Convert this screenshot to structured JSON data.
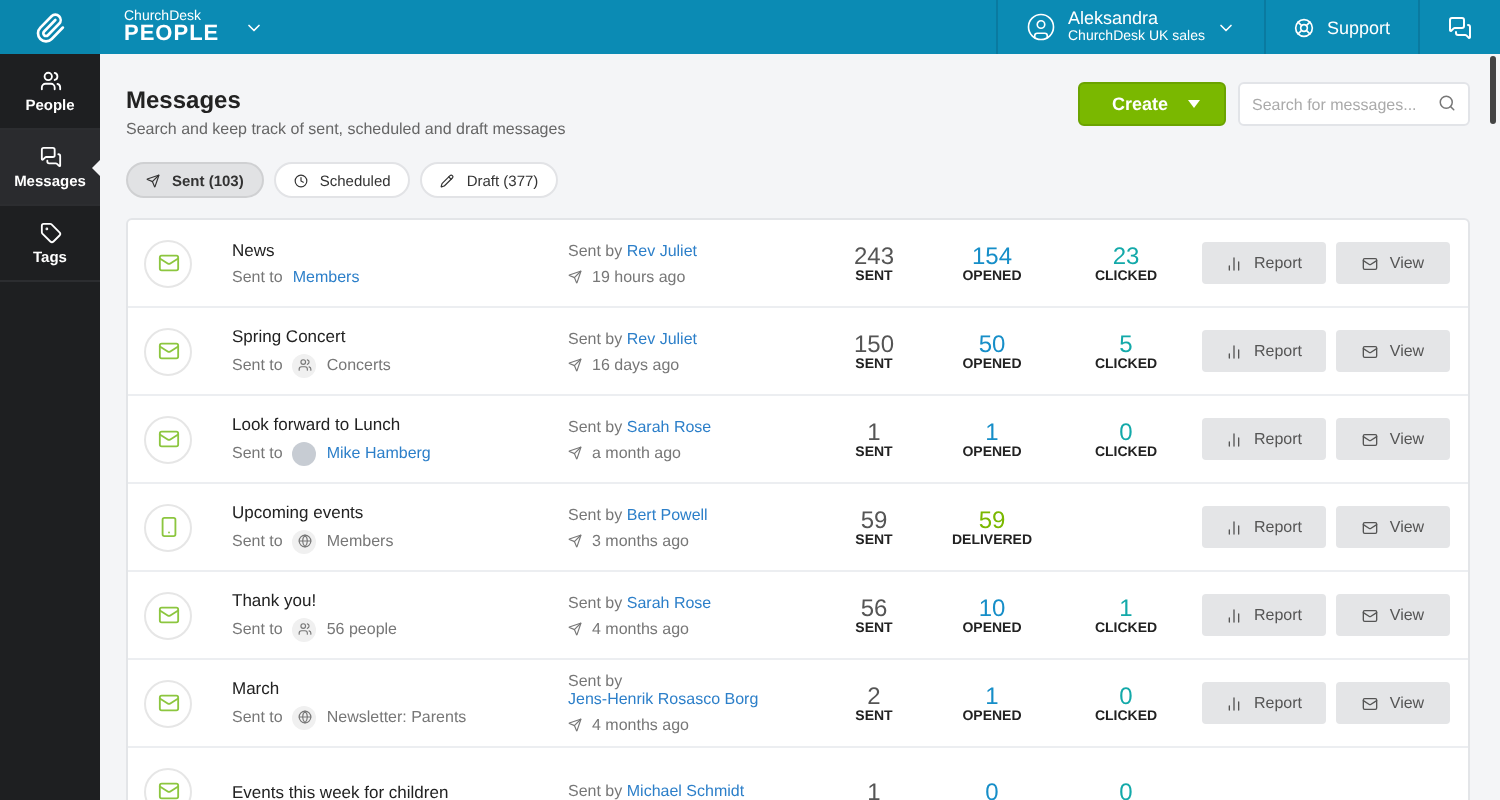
{
  "topbar": {
    "brand_small": "ChurchDesk",
    "brand": "PEOPLE",
    "user": {
      "name": "Aleksandra",
      "org": "ChurchDesk UK sales"
    },
    "support": "Support"
  },
  "sidebar": {
    "items": [
      {
        "kind": "people",
        "label": "People",
        "selected": false
      },
      {
        "kind": "messages",
        "label": "Messages",
        "selected": true
      },
      {
        "kind": "tags",
        "label": "Tags",
        "selected": false
      }
    ]
  },
  "page": {
    "title": "Messages",
    "subtitle": "Search and keep track of sent, scheduled and draft messages",
    "create": "Create",
    "search": {
      "placeholder": "Search for messages..."
    }
  },
  "tabs": [
    {
      "kind": "sent",
      "label": "Sent (103)",
      "selected": true
    },
    {
      "kind": "scheduled",
      "label": "Scheduled",
      "selected": false
    },
    {
      "kind": "draft",
      "label": "Draft (377)",
      "selected": false
    }
  ],
  "messages": [
    {
      "kind": "email",
      "title": "News",
      "sent_to": "Sent to",
      "recipient": {
        "kind": "link",
        "text": "Members"
      },
      "sent_by": "Sent by",
      "author": "Rev Juliet",
      "time": "19 hours ago",
      "stats": [
        {
          "kind": "sent",
          "value": "243",
          "label": "SENT"
        },
        {
          "kind": "opened",
          "value": "154",
          "label": "OPENED"
        },
        {
          "kind": "clicked",
          "value": "23",
          "label": "CLICKED"
        }
      ],
      "report": "Report",
      "view": "View"
    },
    {
      "kind": "email",
      "title": "Spring Concert",
      "sent_to": "Sent to",
      "recipient": {
        "kind": "group",
        "text": "Concerts"
      },
      "sent_by": "Sent by",
      "author": "Rev Juliet",
      "time": "16 days ago",
      "stats": [
        {
          "kind": "sent",
          "value": "150",
          "label": "SENT"
        },
        {
          "kind": "opened",
          "value": "50",
          "label": "OPENED"
        },
        {
          "kind": "clicked",
          "value": "5",
          "label": "CLICKED"
        }
      ],
      "report": "Report",
      "view": "View"
    },
    {
      "kind": "email",
      "title": "Look forward to Lunch",
      "sent_to": "Sent to",
      "recipient": {
        "kind": "person",
        "text": "Mike Hamberg"
      },
      "sent_by": "Sent by",
      "author": "Sarah Rose",
      "time": "a month ago",
      "stats": [
        {
          "kind": "sent",
          "value": "1",
          "label": "SENT"
        },
        {
          "kind": "opened",
          "value": "1",
          "label": "OPENED"
        },
        {
          "kind": "clicked",
          "value": "0",
          "label": "CLICKED"
        }
      ],
      "report": "Report",
      "view": "View"
    },
    {
      "kind": "sms",
      "title": "Upcoming events",
      "sent_to": "Sent to",
      "recipient": {
        "kind": "list",
        "text": "Members"
      },
      "sent_by": "Sent by",
      "author": "Bert Powell",
      "time": "3 months ago",
      "stats": [
        {
          "kind": "sent",
          "value": "59",
          "label": "SENT"
        },
        {
          "kind": "delivered",
          "value": "59",
          "label": "DELIVERED"
        }
      ],
      "report": "Report",
      "view": "View"
    },
    {
      "kind": "email",
      "title": "Thank you!",
      "sent_to": "Sent to",
      "recipient": {
        "kind": "group",
        "text": "56 people"
      },
      "sent_by": "Sent by",
      "author": "Sarah Rose",
      "time": "4 months ago",
      "stats": [
        {
          "kind": "sent",
          "value": "56",
          "label": "SENT"
        },
        {
          "kind": "opened",
          "value": "10",
          "label": "OPENED"
        },
        {
          "kind": "clicked",
          "value": "1",
          "label": "CLICKED"
        }
      ],
      "report": "Report",
      "view": "View"
    },
    {
      "kind": "email",
      "title": "March",
      "sent_to": "Sent to",
      "recipient": {
        "kind": "list",
        "text": "Newsletter: Parents"
      },
      "sent_by": "Sent by",
      "author": "Jens-Henrik Rosasco Borg",
      "time": "4 months ago",
      "stats": [
        {
          "kind": "sent",
          "value": "2",
          "label": "SENT"
        },
        {
          "kind": "opened",
          "value": "1",
          "label": "OPENED"
        },
        {
          "kind": "clicked",
          "value": "0",
          "label": "CLICKED"
        }
      ],
      "report": "Report",
      "view": "View"
    },
    {
      "kind": "email",
      "title": "Events this week for children",
      "sent_by": "Sent by",
      "author": "Michael Schmidt",
      "stats": [
        {
          "kind": "sent",
          "value": "1"
        },
        {
          "kind": "opened",
          "value": "0"
        },
        {
          "kind": "clicked",
          "value": "0"
        }
      ]
    }
  ]
}
